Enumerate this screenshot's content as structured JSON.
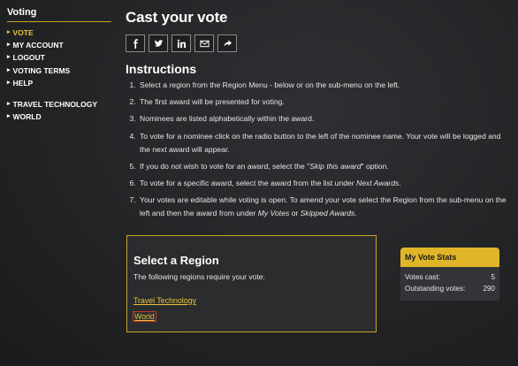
{
  "sidebar": {
    "title": "Voting",
    "items": [
      {
        "label": "VOTE",
        "active": true
      },
      {
        "label": "MY ACCOUNT"
      },
      {
        "label": "LOGOUT"
      },
      {
        "label": "VOTING TERMS"
      },
      {
        "label": "HELP"
      }
    ],
    "regions": [
      {
        "label": "TRAVEL TECHNOLOGY"
      },
      {
        "label": "WORLD"
      }
    ]
  },
  "main": {
    "title": "Cast your vote",
    "share_icons": [
      "facebook-icon",
      "twitter-icon",
      "linkedin-icon",
      "email-icon",
      "share-icon"
    ],
    "instructions_title": "Instructions",
    "instructions": {
      "i1": "Select a region from the Region Menu - below or on the sub-menu on the left.",
      "i2": "The first award will be presented for voting.",
      "i3": "Nominees are listed alphabetically within the award.",
      "i4": "To vote for a nominee click on the radio button to the left of the nominee name. Your vote will be logged and the next award will appear.",
      "i5_pre": "If you do not wish to vote for an award, select the \"",
      "i5_em": "Skip this award",
      "i5_post": "\" option.",
      "i6_pre": "To vote for a specific award, select the award from the list under ",
      "i6_em": "Next Awards",
      "i6_post": ".",
      "i7_pre": "Your votes are editable while voting is open. To amend your vote select the Region from the sub-menu on the left and then the award from under ",
      "i7_em1": "My Votes",
      "i7_mid": " or ",
      "i7_em2": "Skipped Awards",
      "i7_post": "."
    }
  },
  "region_box": {
    "title": "Select a Region",
    "description": "The following regions require your vote:",
    "links": [
      "Travel Technology",
      "World"
    ]
  },
  "stats": {
    "title": "My Vote Stats",
    "votes_cast_label": "Votes cast:",
    "votes_cast": "5",
    "outstanding_label": "Outstanding votes:",
    "outstanding": "290"
  },
  "colors": {
    "accent": "#e0b628",
    "link": "#e8c23a",
    "background": "#222426"
  }
}
